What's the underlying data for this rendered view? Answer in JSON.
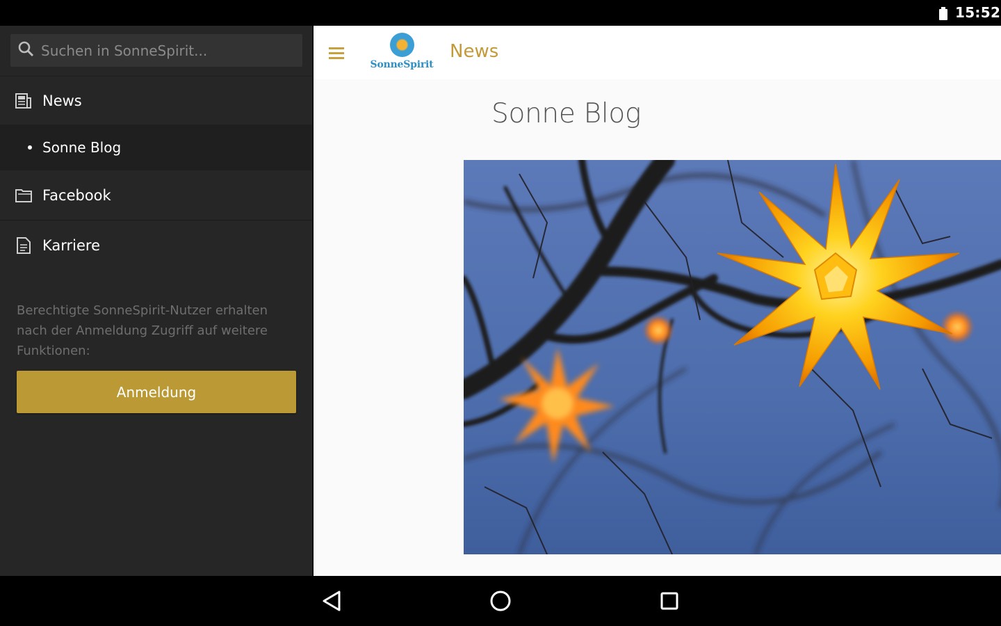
{
  "status_bar": {
    "time": "15:52",
    "battery_icon": "battery-icon"
  },
  "drawer": {
    "search": {
      "placeholder": "Suchen in SonneSpirit...",
      "value": "",
      "icon": "search-icon"
    },
    "items": [
      {
        "label": "News",
        "icon": "news-icon"
      },
      {
        "label": "Sonne Blog",
        "icon": "bullet"
      },
      {
        "label": "Facebook",
        "icon": "folder-icon"
      },
      {
        "label": "Karriere",
        "icon": "document-icon"
      }
    ],
    "info_text": "Berechtigte SonneSpirit-Nutzer erhalten nach der Anmeldung Zugriff auf weitere Funktionen:",
    "login_label": "Anmeldung"
  },
  "appbar": {
    "title": "News",
    "logo_text": "SonneSpirit",
    "menu_icon": "hamburger-menu-icon"
  },
  "content": {
    "page_title": "Sonne Blog"
  },
  "navigation_bar": {
    "icons": [
      "back-icon",
      "home-icon",
      "recents-icon"
    ]
  },
  "colors": {
    "accent": "#bb9a35",
    "drawer_bg": "#262626",
    "title_gold": "#c29a3a",
    "logo_blue": "#2d8fc4"
  }
}
